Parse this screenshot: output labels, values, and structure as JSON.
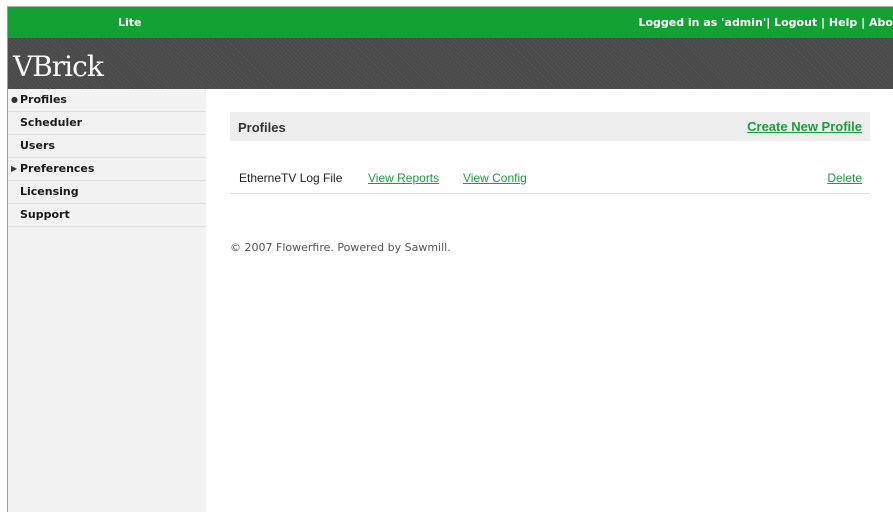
{
  "topbar": {
    "edition": "Lite",
    "logged_in_as": "Logged in as 'admin'|",
    "logout": "Logout",
    "sep1": "|",
    "help": "Help",
    "sep2": "|",
    "about": "About"
  },
  "banner": {
    "logo": "VBrick"
  },
  "sidebar": {
    "items": [
      {
        "label": "Profiles",
        "marker": "●"
      },
      {
        "label": "Scheduler"
      },
      {
        "label": "Users"
      },
      {
        "label": "Preferences",
        "marker": "▶"
      },
      {
        "label": "Licensing"
      },
      {
        "label": "Support"
      }
    ]
  },
  "main": {
    "title": "Profiles",
    "create_label": "Create New Profile",
    "profile": {
      "name": "EtherneTV Log File",
      "view_reports": "View Reports",
      "view_config": "View Config",
      "delete": "Delete"
    },
    "footer": "© 2007 Flowerfire. Powered by Sawmill."
  },
  "colors": {
    "accent_green": "#14a133",
    "link_green": "#1a9e3a",
    "banner": "#4a4a4a"
  }
}
